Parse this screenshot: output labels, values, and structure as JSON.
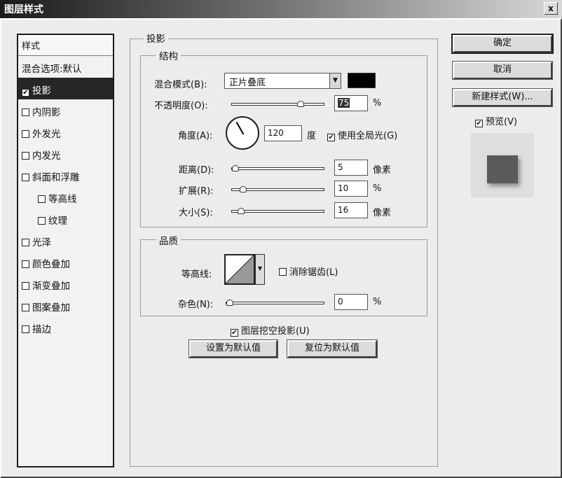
{
  "window": {
    "title": "图层样式",
    "close_label": "x"
  },
  "styles_list": {
    "header": "样式",
    "items": [
      {
        "label": "混合选项:默认",
        "checkbox": false,
        "selected": false,
        "sub": false
      },
      {
        "label": "投影",
        "checkbox": true,
        "checked": true,
        "selected": true,
        "sub": false
      },
      {
        "label": "内阴影",
        "checkbox": true,
        "checked": false,
        "selected": false,
        "sub": false
      },
      {
        "label": "外发光",
        "checkbox": true,
        "checked": false,
        "selected": false,
        "sub": false
      },
      {
        "label": "内发光",
        "checkbox": true,
        "checked": false,
        "selected": false,
        "sub": false
      },
      {
        "label": "斜面和浮雕",
        "checkbox": true,
        "checked": false,
        "selected": false,
        "sub": false
      },
      {
        "label": "等高线",
        "checkbox": true,
        "checked": false,
        "selected": false,
        "sub": true
      },
      {
        "label": "纹理",
        "checkbox": true,
        "checked": false,
        "selected": false,
        "sub": true
      },
      {
        "label": "光泽",
        "checkbox": true,
        "checked": false,
        "selected": false,
        "sub": false
      },
      {
        "label": "颜色叠加",
        "checkbox": true,
        "checked": false,
        "selected": false,
        "sub": false
      },
      {
        "label": "渐变叠加",
        "checkbox": true,
        "checked": false,
        "selected": false,
        "sub": false
      },
      {
        "label": "图案叠加",
        "checkbox": true,
        "checked": false,
        "selected": false,
        "sub": false
      },
      {
        "label": "描边",
        "checkbox": true,
        "checked": false,
        "selected": false,
        "sub": false
      }
    ]
  },
  "drop_shadow": {
    "title": "投影",
    "structure": {
      "title": "结构",
      "blend_mode_label": "混合模式(B):",
      "blend_mode_value": "正片叠底",
      "shadow_color": "#000000",
      "opacity_label": "不透明度(O):",
      "opacity_value": "75",
      "opacity_unit": "%",
      "opacity_fraction": 0.75,
      "angle_label": "角度(A):",
      "angle_value": "120",
      "angle_unit": "度",
      "global_light_label": "使用全局光(G)",
      "global_light_checked": true,
      "distance_label": "距离(D):",
      "distance_value": "5",
      "distance_unit": "像素",
      "spread_label": "扩展(R):",
      "spread_value": "10",
      "spread_unit": "%",
      "size_label": "大小(S):",
      "size_value": "16",
      "size_unit": "像素"
    },
    "quality": {
      "title": "品质",
      "contour_label": "等高线:",
      "anti_alias_label": "消除锯齿(L)",
      "anti_alias_checked": false,
      "noise_label": "杂色(N):",
      "noise_value": "0",
      "noise_unit": "%"
    },
    "knockout_label": "图层挖空投影(U)",
    "knockout_checked": true,
    "make_default_label": "设置为默认值",
    "reset_default_label": "复位为默认值"
  },
  "buttons": {
    "ok": "确定",
    "cancel": "取消",
    "new_style": "新建样式(W)...",
    "preview_label": "预览(V)",
    "preview_checked": true
  }
}
